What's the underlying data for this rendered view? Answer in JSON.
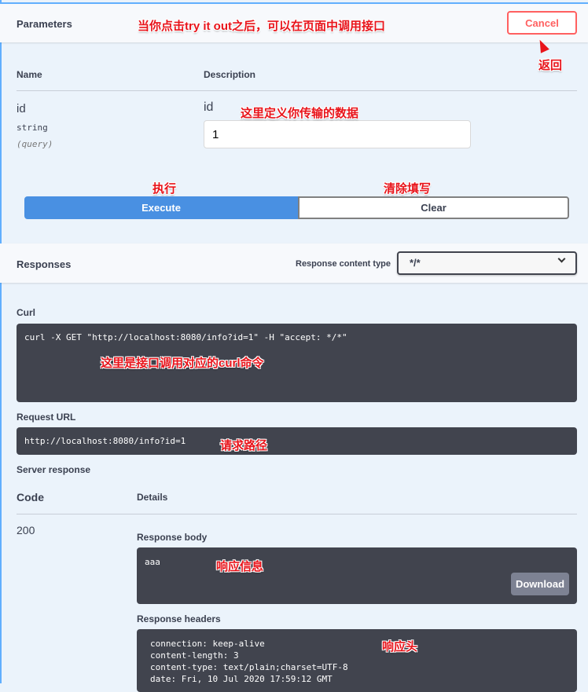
{
  "parameters": {
    "title": "Parameters",
    "cancel": "Cancel",
    "col_name": "Name",
    "col_desc": "Description",
    "param": {
      "name": "id",
      "type": "string",
      "in": "(query)",
      "desc": "id",
      "value": "1"
    },
    "execute": "Execute",
    "clear": "Clear"
  },
  "responses": {
    "title": "Responses",
    "content_type_label": "Response content type",
    "content_type": "*/*",
    "curl_label": "Curl",
    "curl": "curl -X GET \"http://localhost:8080/info?id=1\" -H \"accept: */*\"",
    "request_url_label": "Request URL",
    "request_url": "http://localhost:8080/info?id=1",
    "server_response": "Server response",
    "col_code": "Code",
    "col_details": "Details",
    "code": "200",
    "body_label": "Response body",
    "body": "aaa",
    "download": "Download",
    "headers_label": "Response headers",
    "headers": [
      "connection: keep-alive",
      "content-length: 3",
      "content-type: text/plain;charset=UTF-8",
      "date: Fri, 10 Jul 2020 17:59:12 GMT"
    ]
  },
  "annotations": {
    "try_it": "当你点击try it out之后，可以在页面中调用接口",
    "back": "返回",
    "data": "这里定义你传输的数据",
    "exec": "执行",
    "clear": "清除填写",
    "curl": "这里是接口调用对应的curl命令",
    "path": "请求路径",
    "info": "响应信息",
    "head": "响应头"
  },
  "colors": {
    "accent": "#4990e2",
    "cancel": "#ff6060",
    "dark": "#41444e"
  }
}
